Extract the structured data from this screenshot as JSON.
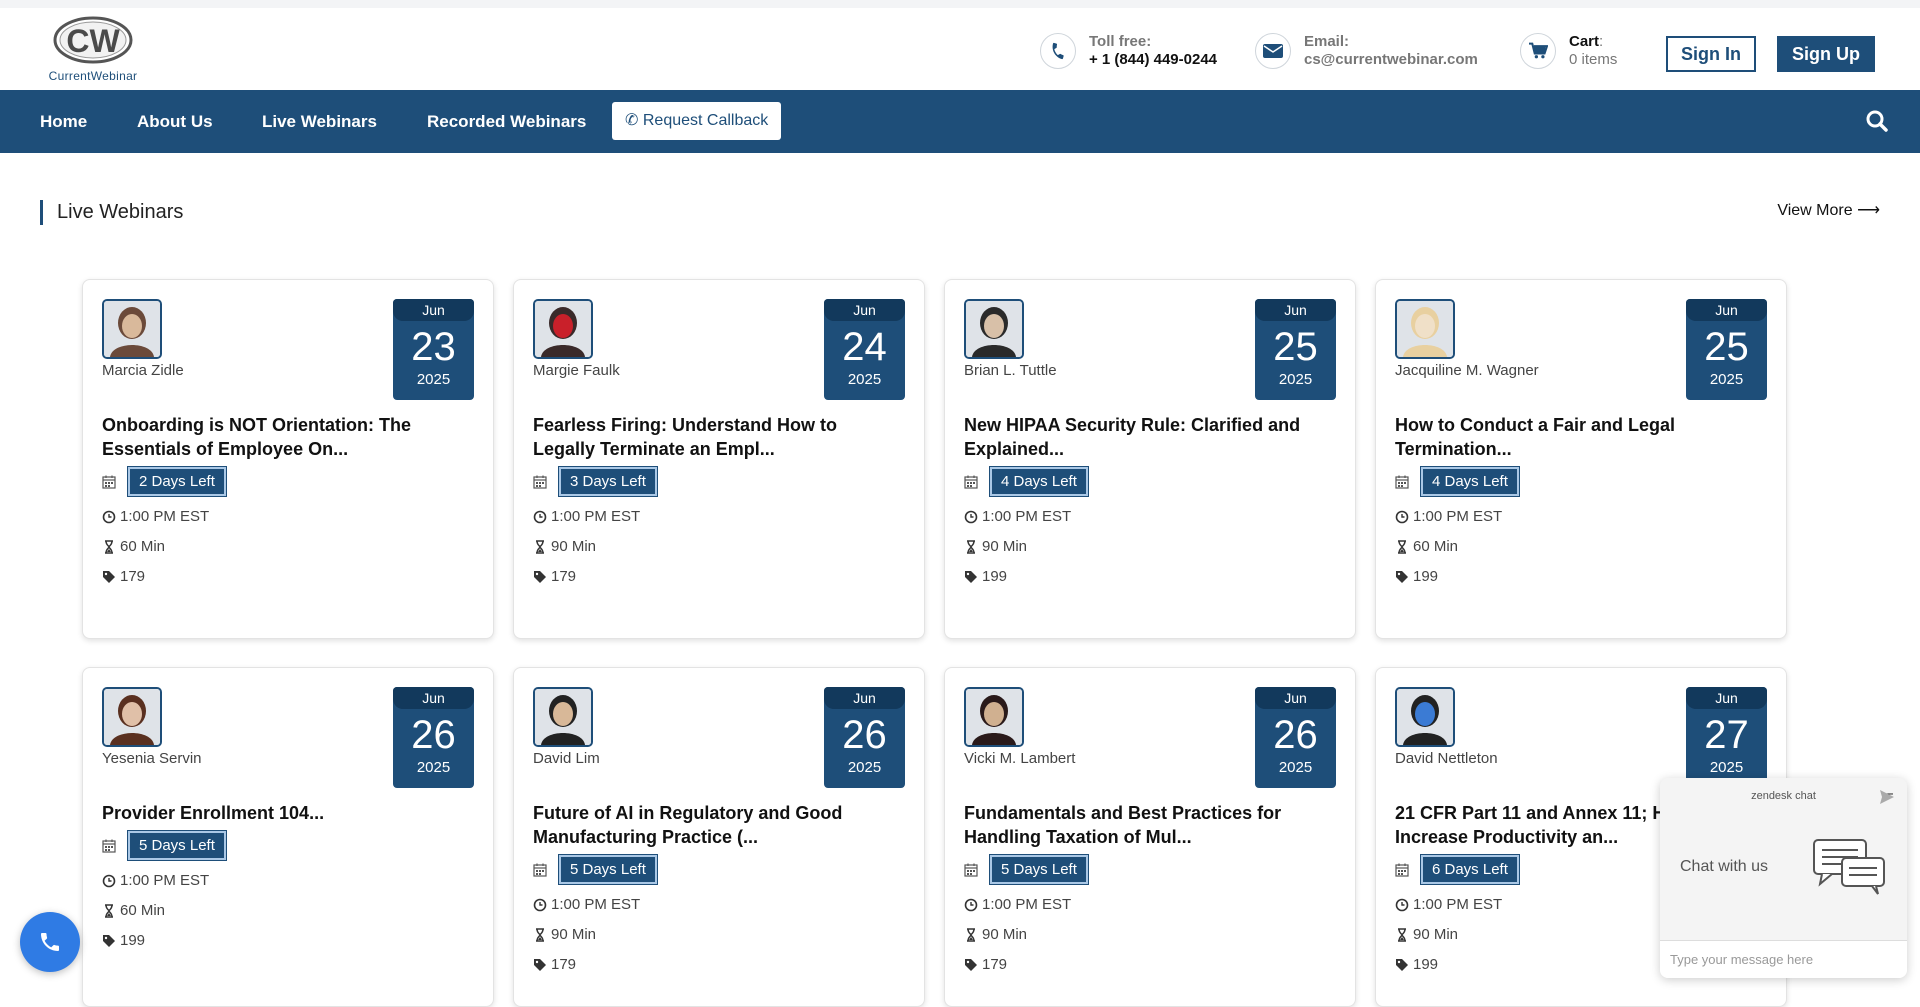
{
  "brand": {
    "logo_letters": "CW",
    "name": "CurrentWebinar"
  },
  "header": {
    "toll_free": {
      "label": "Toll free:",
      "value": "+ 1 (844) 449-0244"
    },
    "email": {
      "label": "Email:",
      "value": "cs@currentwebinar.com"
    },
    "cart": {
      "label": "Cart",
      "colon": ":",
      "value": "0 items"
    },
    "sign_in": "Sign In",
    "sign_up": "Sign Up"
  },
  "nav": {
    "items": [
      "Home",
      "About Us",
      "Live Webinars",
      "Recorded Webinars"
    ],
    "callback": "Request Callback"
  },
  "section": {
    "title": "Live Webinars",
    "view_more": "View More"
  },
  "cards": [
    {
      "name": "Marcia Zidle",
      "month": "Jun",
      "day": "23",
      "year": "2025",
      "title": "Onboarding is NOT Orientation: The Essentials of Employee On...",
      "days_left": "2 Days Left",
      "time": "1:00 PM EST",
      "duration": "60 Min",
      "price": "179"
    },
    {
      "name": "Margie Faulk",
      "month": "Jun",
      "day": "24",
      "year": "2025",
      "title": "Fearless Firing: Understand How to Legally Terminate an Empl...",
      "days_left": "3 Days Left",
      "time": "1:00 PM EST",
      "duration": "90 Min",
      "price": "179"
    },
    {
      "name": "Brian L. Tuttle",
      "month": "Jun",
      "day": "25",
      "year": "2025",
      "title": "New HIPAA Security Rule: Clarified and Explained...",
      "days_left": "4 Days Left",
      "time": "1:00 PM EST",
      "duration": "90 Min",
      "price": "199"
    },
    {
      "name": "Jacquiline M. Wagner",
      "month": "Jun",
      "day": "25",
      "year": "2025",
      "title": "How to Conduct a Fair and Legal Termination...",
      "days_left": "4 Days Left",
      "time": "1:00 PM EST",
      "duration": "60 Min",
      "price": "199"
    },
    {
      "name": "Yesenia Servin",
      "month": "Jun",
      "day": "26",
      "year": "2025",
      "title": "Provider Enrollment 104...",
      "days_left": "5 Days Left",
      "time": "1:00 PM EST",
      "duration": "60 Min",
      "price": "199"
    },
    {
      "name": "David Lim",
      "month": "Jun",
      "day": "26",
      "year": "2025",
      "title": "Future of AI in Regulatory and Good Manufacturing Practice (...",
      "days_left": "5 Days Left",
      "time": "1:00 PM EST",
      "duration": "90 Min",
      "price": "179"
    },
    {
      "name": "Vicki M. Lambert",
      "month": "Jun",
      "day": "26",
      "year": "2025",
      "title": "Fundamentals and Best Practices for Handling Taxation of Mul...",
      "days_left": "5 Days Left",
      "time": "1:00 PM EST",
      "duration": "90 Min",
      "price": "179"
    },
    {
      "name": "David Nettleton",
      "month": "Jun",
      "day": "27",
      "year": "2025",
      "title": "21 CFR Part 11 and Annex 11; How to Increase Productivity an...",
      "days_left": "6 Days Left",
      "time": "1:00 PM EST",
      "duration": "90 Min",
      "price": "199"
    }
  ],
  "chat": {
    "brand": "zendesk chat",
    "minimize": "–",
    "headline": "Chat with us",
    "placeholder": "Type your message here"
  },
  "colors": {
    "primary": "#1e4e79",
    "fab": "#2f7be4"
  }
}
